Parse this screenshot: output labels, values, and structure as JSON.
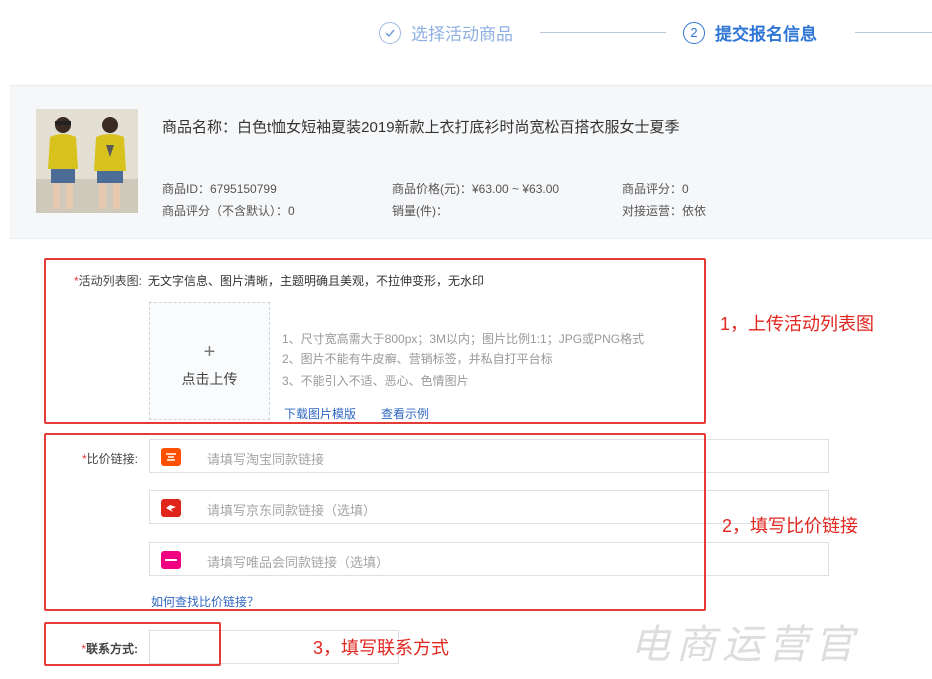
{
  "stepper": {
    "step1": {
      "icon": "check-circle-icon",
      "label": "选择活动商品"
    },
    "step2": {
      "number": "2",
      "label": "提交报名信息"
    }
  },
  "product": {
    "name": "商品名称：白色t恤女短袖夏装2019新款上衣打底衫时尚宽松百搭衣服女士夏季",
    "meta": {
      "id": "商品ID：6795150799",
      "price": "商品价格(元)：¥63.00 ~ ¥63.00",
      "rating": "商品评分：0",
      "rating_default": "商品评分（不含默认）：0",
      "sales": "销量(件)：",
      "ops": "对接运营：依依"
    }
  },
  "form": {
    "list_image": {
      "required": "*",
      "label": "活动列表图:",
      "hint": "无文字信息、图片清晰，主题明确且美观，不拉伸变形，无水印",
      "upload_plus": "+",
      "upload_label": "点击上传",
      "rules": [
        "1、尺寸宽高需大于800px；3M以内；图片比例1:1；JPG或PNG格式",
        "2、图片不能有牛皮癣、营销标签，并私自打平台标",
        "3、不能引入不适、恶心、色情图片"
      ],
      "link_template": "下载图片模版",
      "link_example": "查看示例"
    },
    "price_links": {
      "required": "*",
      "label": "比价链接:",
      "taobao_placeholder": "请填写淘宝同款链接",
      "jd_placeholder": "请填写京东同款链接（选填）",
      "vip_placeholder": "请填写唯品会同款链接（选填）",
      "help_link": "如何查找比价链接？",
      "icons": {
        "taobao": "taobao-icon",
        "jd": "jd-icon",
        "vip": "vipshop-icon"
      }
    },
    "contact": {
      "required": "*",
      "label": "联系方式:",
      "value": ""
    }
  },
  "annotations": {
    "a1": "1，上传活动列表图",
    "a2": "2，填写比价链接",
    "a3": "3，填写联系方式"
  },
  "watermark": "电商运营官",
  "colors": {
    "accent": "#2f76d6",
    "annotation_red": "#e53b36",
    "required_red": "#e4393c",
    "link_blue": "#2f67c2",
    "taobao_orange": "#ff5000",
    "jd_red": "#e1251b",
    "vip_pink": "#f10180"
  }
}
